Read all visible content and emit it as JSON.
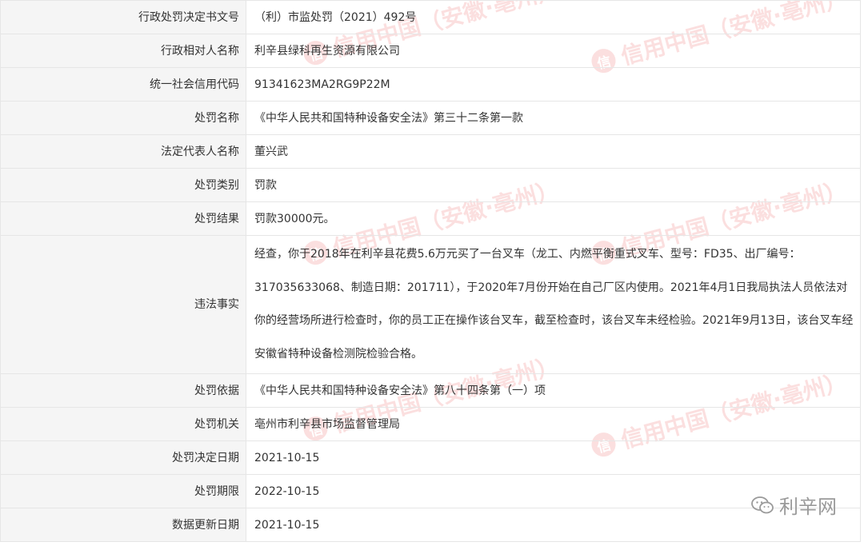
{
  "rows": [
    {
      "label": "行政处罚决定书文号",
      "value": "（利）市监处罚（2021）492号"
    },
    {
      "label": "行政相对人名称",
      "value": "利辛县绿科再生资源有限公司"
    },
    {
      "label": "统一社会信用代码",
      "value": "91341623MA2RG9P22M"
    },
    {
      "label": "处罚名称",
      "value": "《中华人民共和国特种设备安全法》第三十二条第一款"
    },
    {
      "label": "法定代表人名称",
      "value": "董兴武"
    },
    {
      "label": "处罚类别",
      "value": "罚款"
    },
    {
      "label": "处罚结果",
      "value": "罚款30000元。"
    },
    {
      "label": "违法事实",
      "value": "经查，你于2018年在利辛县花费5.6万元买了一台叉车（龙工、内燃平衡重式叉车、型号：FD35、出厂编号：317035633068、制造日期：201711），于2020年7月份开始在自己厂区内使用。2021年4月1日我局执法人员依法对你的经营场所进行检查时，你的员工正在操作该台叉车，截至检查时，该台叉车未经检验。2021年9月13日，该台叉车经安徽省特种设备检测院检验合格。"
    },
    {
      "label": "处罚依据",
      "value": "《中华人民共和国特种设备安全法》第八十四条第（一）项"
    },
    {
      "label": "处罚机关",
      "value": "亳州市利辛县市场监督管理局"
    },
    {
      "label": "处罚决定日期",
      "value": "2021-10-15"
    },
    {
      "label": "处罚期限",
      "value": "2022-10-15"
    },
    {
      "label": "数据更新日期",
      "value": "2021-10-15"
    }
  ],
  "watermark": {
    "text": "信用中国（安徽·亳州）",
    "logo_char": "信",
    "color": "#ec6e6e"
  },
  "footer": {
    "brand": "利辛网",
    "icon": "wechat-icon"
  }
}
